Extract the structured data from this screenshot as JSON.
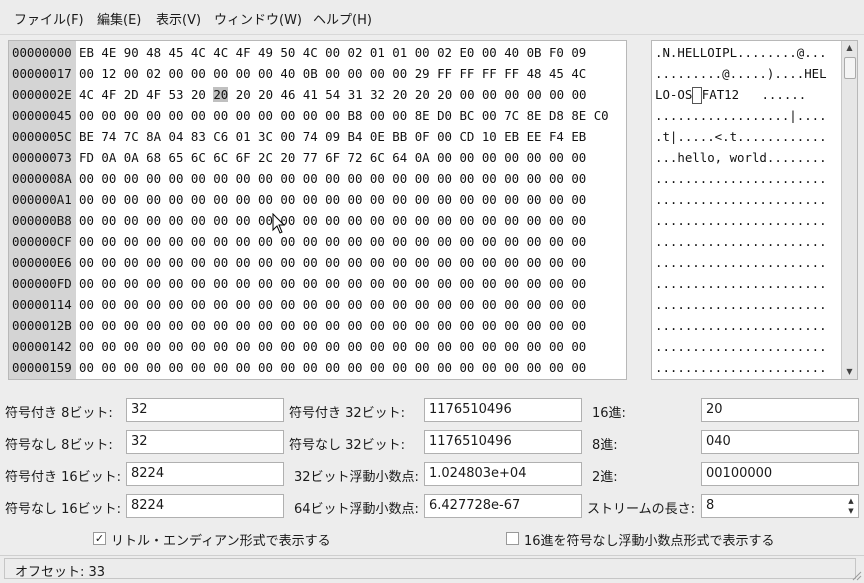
{
  "menubar": {
    "items": [
      "ファイル(F)",
      "編集(E)",
      "表示(V)",
      "ウィンドウ(W)",
      "ヘルプ(H)"
    ]
  },
  "hex_view": {
    "selected_row": 2,
    "selected_byte": 6,
    "rows": [
      {
        "offset": "00000000",
        "bytes": "EB 4E 90 48 45 4C 4C 4F 49 50 4C 00 02 01 01 00 02 E0 00 40 0B F0 09",
        "ascii": ".N.HELLOIPL........@..."
      },
      {
        "offset": "00000017",
        "bytes": "00 12 00 02 00 00 00 00 00 40 0B 00 00 00 00 29 FF FF FF FF 48 45 4C",
        "ascii": ".........@.....)....HEL"
      },
      {
        "offset": "0000002E",
        "bytes": "4C 4F 2D 4F 53 20 20 20 20 46 41 54 31 32 20 20 20 00 00 00 00 00 00",
        "ascii": "LO-OS FAT12   ......"
      },
      {
        "offset": "00000045",
        "bytes": "00 00 00 00 00 00 00 00 00 00 00 00 B8 00 00 8E D0 BC 00 7C 8E D8 8E C0",
        "ascii": "..................|...."
      },
      {
        "offset": "0000005C",
        "bytes": "BE 74 7C 8A 04 83 C6 01 3C 00 74 09 B4 0E BB 0F 00 CD 10 EB EE F4 EB",
        "ascii": ".t|.....<.t............"
      },
      {
        "offset": "00000073",
        "bytes": "FD 0A 0A 68 65 6C 6C 6F 2C 20 77 6F 72 6C 64 0A 00 00 00 00 00 00 00",
        "ascii": "...hello, world........"
      },
      {
        "offset": "0000008A",
        "bytes": "00 00 00 00 00 00 00 00 00 00 00 00 00 00 00 00 00 00 00 00 00 00 00",
        "ascii": "......................."
      },
      {
        "offset": "000000A1",
        "bytes": "00 00 00 00 00 00 00 00 00 00 00 00 00 00 00 00 00 00 00 00 00 00 00",
        "ascii": "......................."
      },
      {
        "offset": "000000B8",
        "bytes": "00 00 00 00 00 00 00 00 00 00 00 00 00 00 00 00 00 00 00 00 00 00 00",
        "ascii": "......................."
      },
      {
        "offset": "000000CF",
        "bytes": "00 00 00 00 00 00 00 00 00 00 00 00 00 00 00 00 00 00 00 00 00 00 00",
        "ascii": "......................."
      },
      {
        "offset": "000000E6",
        "bytes": "00 00 00 00 00 00 00 00 00 00 00 00 00 00 00 00 00 00 00 00 00 00 00",
        "ascii": "......................."
      },
      {
        "offset": "000000FD",
        "bytes": "00 00 00 00 00 00 00 00 00 00 00 00 00 00 00 00 00 00 00 00 00 00 00",
        "ascii": "......................."
      },
      {
        "offset": "00000114",
        "bytes": "00 00 00 00 00 00 00 00 00 00 00 00 00 00 00 00 00 00 00 00 00 00 00",
        "ascii": "......................."
      },
      {
        "offset": "0000012B",
        "bytes": "00 00 00 00 00 00 00 00 00 00 00 00 00 00 00 00 00 00 00 00 00 00 00",
        "ascii": "......................."
      },
      {
        "offset": "00000142",
        "bytes": "00 00 00 00 00 00 00 00 00 00 00 00 00 00 00 00 00 00 00 00 00 00 00",
        "ascii": "......................."
      },
      {
        "offset": "00000159",
        "bytes": "00 00 00 00 00 00 00 00 00 00 00 00 00 00 00 00 00 00 00 00 00 00 00",
        "ascii": "......................."
      }
    ]
  },
  "fields": {
    "signed8_label": "符号付き 8ビット:",
    "signed8_value": "32",
    "unsigned8_label": "符号なし 8ビット:",
    "unsigned8_value": "32",
    "signed16_label": "符号付き 16ビット:",
    "signed16_value": "8224",
    "unsigned16_label": "符号なし 16ビット:",
    "unsigned16_value": "8224",
    "signed32_label": "符号付き 32ビット:",
    "signed32_value": "1176510496",
    "unsigned32_label": "符号なし 32ビット:",
    "unsigned32_value": "1176510496",
    "float32_label": "32ビット浮動小数点:",
    "float32_value": "1.024803e+04",
    "float64_label": "64ビット浮動小数点:",
    "float64_value": "6.427728e-67",
    "hex_label": "16進:",
    "hex_value": "20",
    "octal_label": "8進:",
    "octal_value": "040",
    "binary_label": "2進:",
    "binary_value": "00100000",
    "stream_length_label": "ストリームの長さ:",
    "stream_length_value": "8"
  },
  "options": {
    "little_endian_label": "リトル・エンディアン形式で表示する",
    "little_endian_checked": true,
    "hex_unsigned_float_label": "16進を符号なし浮動小数点形式で表示する",
    "hex_unsigned_float_checked": false
  },
  "status": {
    "offset_text": "オフセット: 33"
  }
}
